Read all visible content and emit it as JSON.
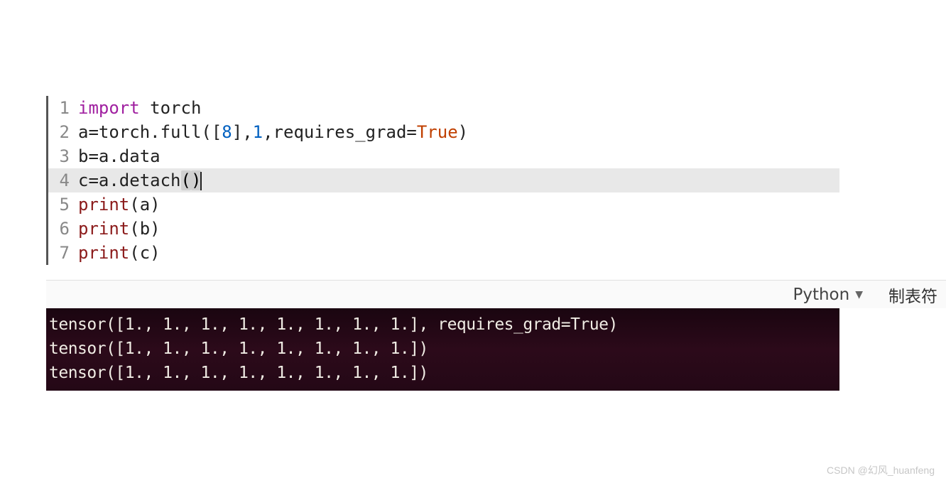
{
  "code": {
    "lines": [
      {
        "num": "1",
        "tokens": [
          {
            "cls": "kw-import",
            "t": "import"
          },
          {
            "cls": "plain",
            "t": " torch"
          }
        ]
      },
      {
        "num": "2",
        "tokens": [
          {
            "cls": "plain",
            "t": "a=torch.full(["
          },
          {
            "cls": "num",
            "t": "8"
          },
          {
            "cls": "plain",
            "t": "],"
          },
          {
            "cls": "num",
            "t": "1"
          },
          {
            "cls": "plain",
            "t": ",requires_grad="
          },
          {
            "cls": "kw-true",
            "t": "True"
          },
          {
            "cls": "plain",
            "t": ")"
          }
        ]
      },
      {
        "num": "3",
        "tokens": [
          {
            "cls": "plain",
            "t": "b=a.data"
          }
        ]
      },
      {
        "num": "4",
        "current": true,
        "tokens": [
          {
            "cls": "plain",
            "t": "c=a.detach"
          },
          {
            "cls": "paren-match",
            "t": "("
          },
          {
            "cls": "paren-match",
            "t": ")"
          }
        ],
        "cursor": true
      },
      {
        "num": "5",
        "tokens": [
          {
            "cls": "kw-builtin",
            "t": "print"
          },
          {
            "cls": "plain",
            "t": "(a)"
          }
        ]
      },
      {
        "num": "6",
        "tokens": [
          {
            "cls": "kw-builtin",
            "t": "print"
          },
          {
            "cls": "plain",
            "t": "(b)"
          }
        ]
      },
      {
        "num": "7",
        "tokens": [
          {
            "cls": "kw-builtin",
            "t": "print"
          },
          {
            "cls": "plain",
            "t": "(c)"
          }
        ]
      }
    ]
  },
  "statusbar": {
    "language": "Python",
    "tabinfo": "制表符"
  },
  "terminal": {
    "lines": [
      "tensor([1., 1., 1., 1., 1., 1., 1., 1.], requires_grad=True)",
      "tensor([1., 1., 1., 1., 1., 1., 1., 1.])",
      "tensor([1., 1., 1., 1., 1., 1., 1., 1.])"
    ]
  },
  "watermark": "CSDN @幻风_huanfeng"
}
